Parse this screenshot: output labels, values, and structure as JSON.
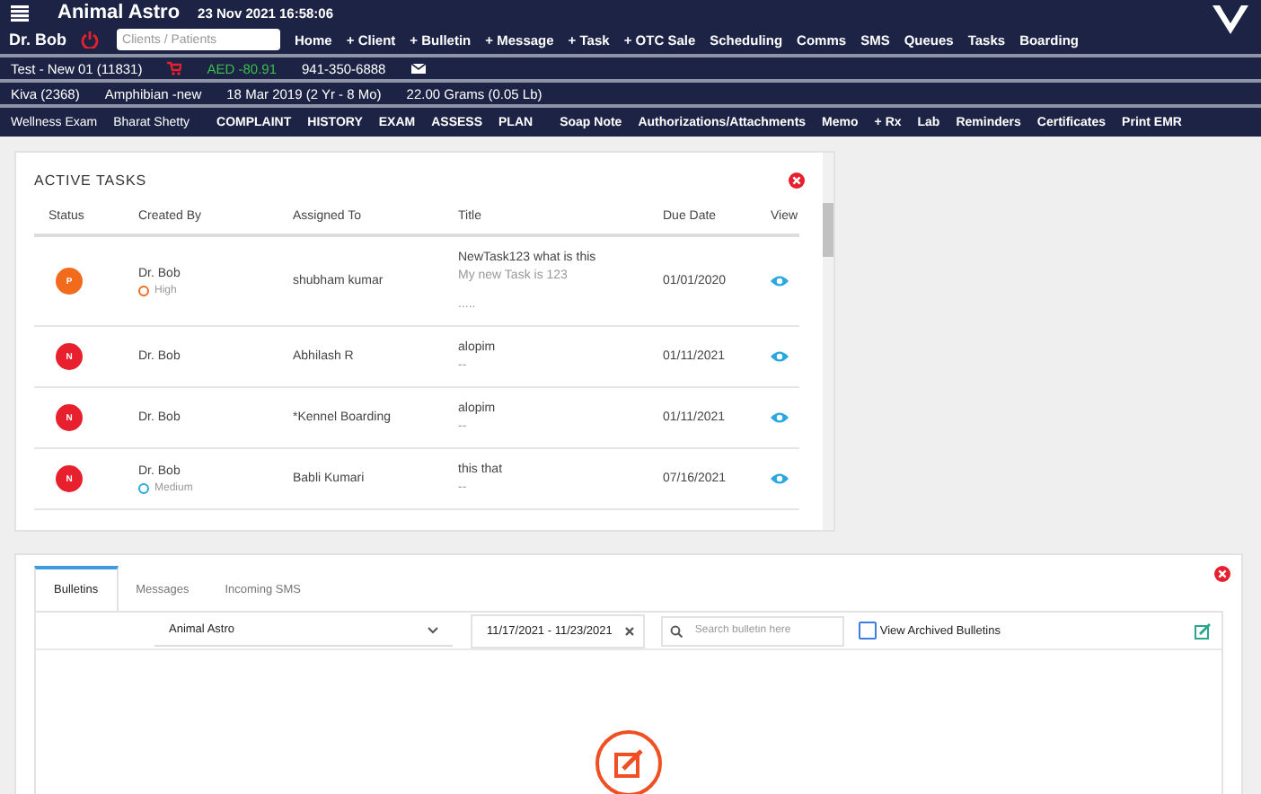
{
  "header": {
    "app_title": "Animal Astro",
    "datetime": "23 Nov 2021 16:58:06",
    "user": "Dr. Bob",
    "search": {
      "placeholder": "Clients / Patients"
    },
    "nav": [
      "Home",
      "+ Client",
      "+ Bulletin",
      "+ Message",
      "+ Task",
      "+ OTC Sale",
      "Scheduling",
      "Comms",
      "SMS",
      "Queues",
      "Tasks",
      "Boarding"
    ]
  },
  "client_bar": {
    "client": "Test - New 01 (11831)",
    "balance": "AED -80.91",
    "phone": "941-350-6888"
  },
  "patient_bar": {
    "patient": "Kiva (2368)",
    "species": "Amphibian -new",
    "birth": "18 Mar 2019 (2 Yr - 8 Mo)",
    "weight": "22.00 Grams (0.05 Lb)"
  },
  "visit_bar": {
    "visit": "Wellness Exam",
    "doctor": "Bharat Shetty",
    "links": [
      "COMPLAINT",
      "HISTORY",
      "EXAM",
      "ASSESS",
      "PLAN",
      "Soap Note",
      "Authorizations/Attachments",
      "Memo",
      "+ Rx",
      "Lab",
      "Reminders",
      "Certificates",
      "Print EMR"
    ]
  },
  "active_tasks": {
    "title": "ACTIVE TASKS",
    "columns": [
      "Status",
      "Created By",
      "Assigned To",
      "Title",
      "Due Date",
      "View"
    ],
    "rows": [
      {
        "status": "P",
        "color": "#f26a1b",
        "created_by": "Dr. Bob",
        "priority": {
          "label": "High",
          "color": "#f26a1b"
        },
        "assigned_to": "shubham kumar",
        "title": "NewTask123 what is this",
        "description": "My new Task is 123",
        "extra": ".....",
        "due_date": "01/01/2020"
      },
      {
        "status": "N",
        "color": "#e8202e",
        "created_by": "Dr. Bob",
        "assigned_to": "Abhilash R",
        "title": "alopim",
        "description": "--",
        "due_date": "01/11/2021"
      },
      {
        "status": "N",
        "color": "#e8202e",
        "created_by": "Dr. Bob",
        "assigned_to": "*Kennel Boarding",
        "title": "alopim",
        "description": "--",
        "due_date": "01/11/2021"
      },
      {
        "status": "N",
        "color": "#e8202e",
        "created_by": "Dr. Bob",
        "priority": {
          "label": "Medium",
          "color": "#29a8e0"
        },
        "assigned_to": "Babli Kumari",
        "title": "this that",
        "description": "--",
        "due_date": "07/16/2021"
      }
    ]
  },
  "bulletins": {
    "tabs": [
      {
        "label": "Bulletins",
        "selected": true
      },
      {
        "label": "Messages",
        "selected": false
      },
      {
        "label": "Incoming SMS",
        "selected": false
      }
    ],
    "clinic": "Animal Astro",
    "date_range": "11/17/2021 - 11/23/2021",
    "search": {
      "placeholder": "Search bulletin here"
    },
    "view_archived": {
      "label": "View Archived Bulletins",
      "checked": false
    }
  }
}
